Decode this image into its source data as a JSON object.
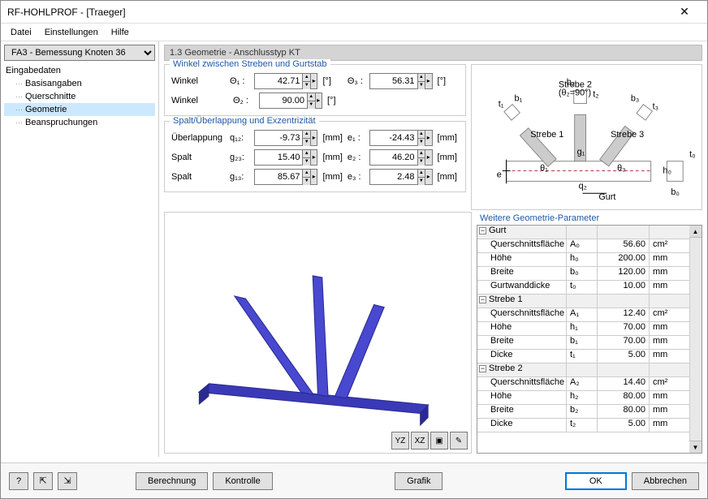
{
  "window": {
    "title": "RF-HOHLPROF - [Traeger]"
  },
  "menu": {
    "file": "Datei",
    "settings": "Einstellungen",
    "help": "Hilfe"
  },
  "sidebar": {
    "combo": "FA3 - Bemessung Knoten 36",
    "root": "Eingabedaten",
    "items": [
      "Basisangaben",
      "Querschnitte",
      "Geometrie",
      "Beanspruchungen"
    ],
    "selected": 2
  },
  "header": "1.3 Geometrie - Anschlusstyp KT",
  "group1": {
    "legend": "Winkel zwischen Streben und Gurtstab",
    "rows": [
      {
        "label": "Winkel",
        "sym": "Θ₁ :",
        "val": "42.71",
        "unit": "[°]",
        "sym2": "Θ₃ :",
        "val2": "56.31",
        "unit2": "[°]"
      },
      {
        "label": "Winkel",
        "sym": "Θ₂ :",
        "val": "90.00",
        "unit": "[°]"
      }
    ]
  },
  "group2": {
    "legend": "Spalt/Überlappung und Exzentrizität",
    "rows": [
      {
        "label": "Überlappung",
        "sym": "q₁₂:",
        "val": "-9.73",
        "unit": "[mm]",
        "sym2": "e₁ :",
        "val2": "-24.43",
        "unit2": "[mm]"
      },
      {
        "label": "Spalt",
        "sym": "g₂₃:",
        "val": "15.40",
        "unit": "[mm]",
        "sym2": "e₂ :",
        "val2": "46.20",
        "unit2": "[mm]"
      },
      {
        "label": "Spalt",
        "sym": "g₁₃:",
        "val": "85.67",
        "unit": "[mm]",
        "sym2": "e₃ :",
        "val2": "2.48",
        "unit2": "[mm]"
      }
    ]
  },
  "diagram_labels": {
    "s1": "Strebe 1",
    "s2": "Strebe 2",
    "s2a": "(θ₂=90°)",
    "s3": "Strebe 3",
    "gurt": "Gurt"
  },
  "params": {
    "legend": "Weitere Geometrie-Parameter",
    "sections": [
      {
        "name": "Gurt",
        "rows": [
          {
            "label": "Querschnittsfläche",
            "sym": "A₀",
            "val": "56.60",
            "unit": "cm²"
          },
          {
            "label": "Höhe",
            "sym": "h₀",
            "val": "200.00",
            "unit": "mm"
          },
          {
            "label": "Breite",
            "sym": "b₀",
            "val": "120.00",
            "unit": "mm"
          },
          {
            "label": "Gurtwanddicke",
            "sym": "t₀",
            "val": "10.00",
            "unit": "mm"
          }
        ]
      },
      {
        "name": "Strebe 1",
        "rows": [
          {
            "label": "Querschnittsfläche",
            "sym": "A₁",
            "val": "12.40",
            "unit": "cm²"
          },
          {
            "label": "Höhe",
            "sym": "h₁",
            "val": "70.00",
            "unit": "mm"
          },
          {
            "label": "Breite",
            "sym": "b₁",
            "val": "70.00",
            "unit": "mm"
          },
          {
            "label": "Dicke",
            "sym": "t₁",
            "val": "5.00",
            "unit": "mm"
          }
        ]
      },
      {
        "name": "Strebe 2",
        "rows": [
          {
            "label": "Querschnittsfläche",
            "sym": "A₂",
            "val": "14.40",
            "unit": "cm²"
          },
          {
            "label": "Höhe",
            "sym": "h₂",
            "val": "80.00",
            "unit": "mm"
          },
          {
            "label": "Breite",
            "sym": "b₂",
            "val": "80.00",
            "unit": "mm"
          },
          {
            "label": "Dicke",
            "sym": "t₂",
            "val": "5.00",
            "unit": "mm"
          }
        ]
      }
    ]
  },
  "footer": {
    "calc": "Berechnung",
    "check": "Kontrolle",
    "graphic": "Grafik",
    "ok": "OK",
    "cancel": "Abbrechen"
  }
}
